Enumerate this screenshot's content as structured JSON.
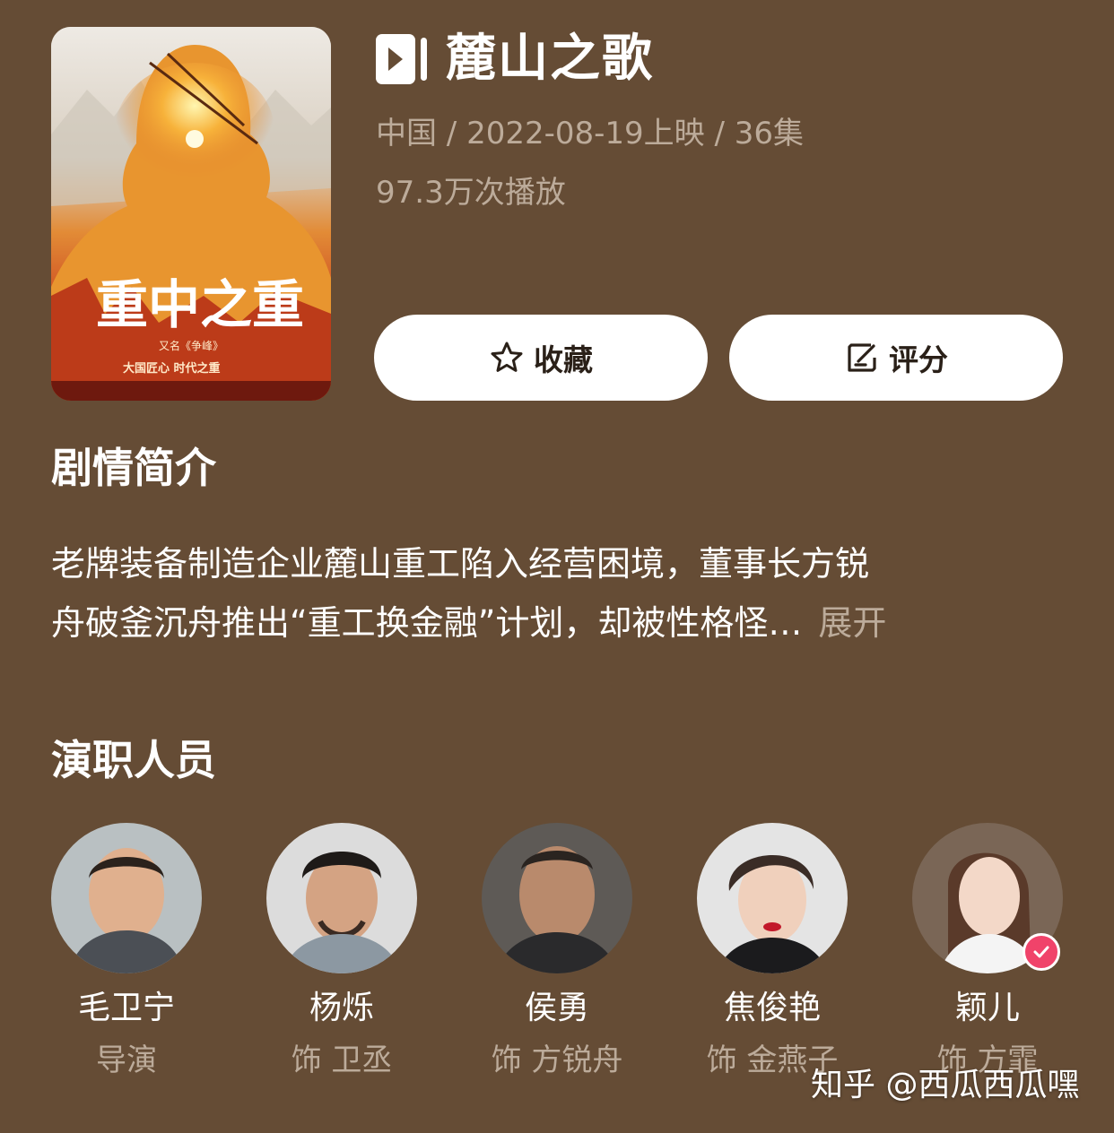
{
  "show": {
    "title": "麓山之歌",
    "meta": "中国 / 2022-08-19上映 / 36集",
    "plays": "97.3万次播放",
    "poster_icon": "drama-poster"
  },
  "actions": {
    "favorite_label": "收藏",
    "favorite_icon": "star-icon",
    "rate_label": "评分",
    "rate_icon": "edit-icon"
  },
  "synopsis": {
    "heading": "剧情简介",
    "line1": "老牌装备制造企业麓山重工陷入经营困境，董事长方锐",
    "line2": "舟破釜沉舟推出“重工换金融”计划，却被性格怪…",
    "expand_label": "展开"
  },
  "cast": {
    "heading": "演职人员",
    "members": [
      {
        "name": "毛卫宁",
        "role": "导演"
      },
      {
        "name": "杨烁",
        "role": "饰 卫丞"
      },
      {
        "name": "侯勇",
        "role": "饰 方锐舟"
      },
      {
        "name": "焦俊艳",
        "role": "饰 金燕子"
      },
      {
        "name": "颖儿",
        "role": "饰 方霏",
        "verified": true
      }
    ]
  },
  "watermark": "知乎 @西瓜西瓜嘿",
  "colors": {
    "background": "#654c35",
    "secondary_text": "#bcab9a",
    "verified_badge": "#f0436a"
  }
}
